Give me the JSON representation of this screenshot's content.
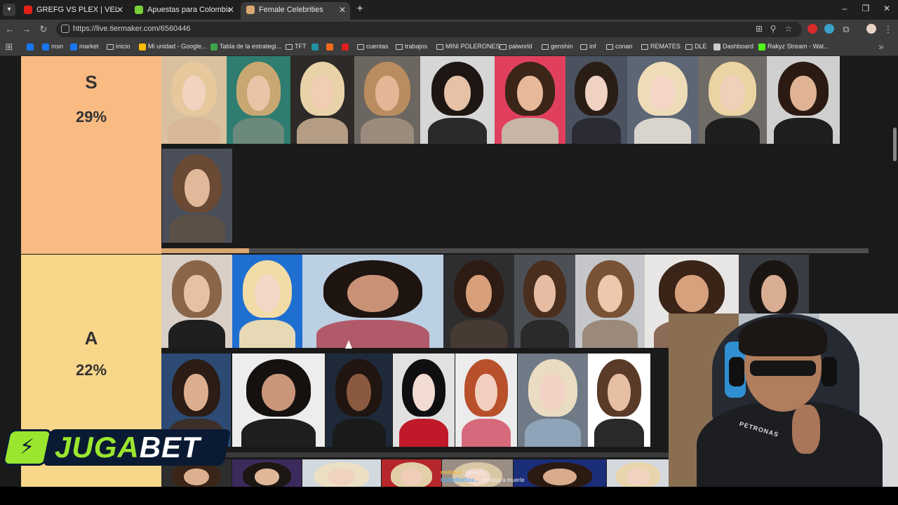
{
  "browser": {
    "tabs": [
      {
        "title": "GREFG VS PLEX | VELADA DEL AÑO",
        "favicon_color": "#e62117",
        "active": false
      },
      {
        "title": "Apuestas para Colombia vs Francia",
        "favicon_color": "#7ad03a",
        "active": false
      },
      {
        "title": "Female Celebrities",
        "favicon_color": "#d9a870",
        "active": true
      }
    ],
    "url": "https://live.tiermaker.com/6560446",
    "new_tab_symbol": "+",
    "bookmarks": [
      {
        "label": "",
        "kind": "site",
        "color": "#1877f2"
      },
      {
        "label": "msn",
        "kind": "site",
        "color": "#1877f2"
      },
      {
        "label": "market",
        "kind": "site",
        "color": "#1877f2"
      },
      {
        "label": "inicio",
        "kind": "folder"
      },
      {
        "label": "Mi unidad - Google...",
        "kind": "site",
        "color": "#fbbc04"
      },
      {
        "label": "Tabla de la estrategi...",
        "kind": "site",
        "color": "#3fa34d"
      },
      {
        "label": "TFT",
        "kind": "folder"
      },
      {
        "label": "",
        "kind": "site",
        "color": "#1e90a0"
      },
      {
        "label": "",
        "kind": "site",
        "color": "#f26b1d"
      },
      {
        "label": "",
        "kind": "site",
        "color": "#e01e1e"
      },
      {
        "label": "cuentas",
        "kind": "folder"
      },
      {
        "label": "trabajos",
        "kind": "folder"
      },
      {
        "label": "MINI POLERONES",
        "kind": "folder"
      },
      {
        "label": "palworld",
        "kind": "folder"
      },
      {
        "label": "genshin",
        "kind": "folder"
      },
      {
        "label": "inf",
        "kind": "folder"
      },
      {
        "label": "conan",
        "kind": "folder"
      },
      {
        "label": "REMATES",
        "kind": "folder"
      },
      {
        "label": "DLE",
        "kind": "folder"
      },
      {
        "label": "Dashboard",
        "kind": "site",
        "color": "#cccccc"
      },
      {
        "label": "Rakyz Stream - Wat...",
        "kind": "site",
        "color": "#53fc18"
      }
    ]
  },
  "tierlist": {
    "tiers": [
      {
        "letter": "S",
        "percent": "29%",
        "color": "#f9bb82"
      },
      {
        "letter": "A",
        "percent": "22%",
        "color": "#f9d78a"
      }
    ],
    "s_row_photos": [
      {
        "hair": "#e7c89c",
        "skin": "#f1d3bf",
        "bg": "#d9c1a0",
        "cloth": "#d8b898"
      },
      {
        "hair": "#c9a773",
        "skin": "#e9c4a6",
        "bg": "#2f7d70",
        "cloth": "#6b8a7c"
      },
      {
        "hair": "#e8d3a8",
        "skin": "#f0cdb3",
        "bg": "#2d2a28",
        "cloth": "#b49d84"
      },
      {
        "hair": "#b98d5f",
        "skin": "#e3b696",
        "bg": "#6c6660",
        "cloth": "#9a8b7c"
      },
      {
        "hair": "#1d1613",
        "skin": "#e6c1a6",
        "bg": "#d6d6d6",
        "cloth": "#2a2a2a"
      },
      {
        "hair": "#3b2518",
        "skin": "#e7b99b",
        "bg": "#e0405e",
        "cloth": "#c7b6a8"
      },
      {
        "hair": "#2a1d16",
        "skin": "#f0d2c2",
        "bg": "#4a5260",
        "cloth": "#2b2b33"
      },
      {
        "hair": "#eedcb8",
        "skin": "#f3d6c6",
        "bg": "#5c6675",
        "cloth": "#d9d4cc"
      },
      {
        "hair": "#ead4a3",
        "skin": "#f0cfbb",
        "bg": "#6f6b66",
        "cloth": "#1e1e1e"
      },
      {
        "hair": "#2a1a12",
        "skin": "#e0b394",
        "bg": "#cfcfcf",
        "cloth": "#1e1e1e"
      },
      {
        "hair": "#6a4a34",
        "skin": "#e1b899",
        "bg": "#4a4e58",
        "cloth": "#5b5046"
      }
    ],
    "a_row1_photos": [
      {
        "hair": "#8a6548",
        "skin": "#e8c0a2",
        "bg": "#d9cfc6",
        "cloth": "#1f1f1f"
      },
      {
        "hair": "#f1dba7",
        "skin": "#f3d7c7",
        "bg": "#1f6fd1",
        "cloth": "#e7d9b6"
      },
      {
        "hair": "#1e1410",
        "skin": "#c99276",
        "bg": "#bcd0e3",
        "cloth": "#b05a6a"
      },
      {
        "hair": "#2d1c14",
        "skin": "#d7a07a",
        "bg": "#2e2e30",
        "cloth": "#463a33"
      },
      {
        "hair": "#4a2e1e",
        "skin": "#e6bda3",
        "bg": "#4c4f55",
        "cloth": "#2a2a2a"
      },
      {
        "hair": "#7a5236",
        "skin": "#eec7ad",
        "bg": "#c4c6ca",
        "cloth": "#9b8a7b"
      },
      {
        "hair": "#3a2418",
        "skin": "#d8a17e",
        "bg": "#e8e6e4",
        "cloth": "#8b6a57"
      },
      {
        "hair": "#1b1512",
        "skin": "#d8ad92",
        "bg": "#3a3c44",
        "cloth": "#2b2b2b"
      }
    ],
    "a_row2_photos": [
      {
        "hair": "#2b1d16",
        "skin": "#dcae90",
        "bg": "#2c4a73",
        "cloth": "#3c2e28"
      },
      {
        "hair": "#15110f",
        "skin": "#c9967a",
        "bg": "#ededed",
        "cloth": "#1e1e1e"
      },
      {
        "hair": "#201510",
        "skin": "#8a5a40",
        "bg": "#1e2a3a",
        "cloth": "#1a1a1a"
      },
      {
        "hair": "#0f0f12",
        "skin": "#f2dcd2",
        "bg": "#e1e1e1",
        "cloth": "#c01a2a"
      },
      {
        "hair": "#b8502c",
        "skin": "#f2cfc0",
        "bg": "#ececec",
        "cloth": "#d66a7c"
      },
      {
        "hair": "#e9dcc2",
        "skin": "#f2d2c4",
        "bg": "#6f7a86",
        "cloth": "#8fa4b8"
      },
      {
        "hair": "#5a3a28",
        "skin": "#e7bfa3",
        "bg": "#ffffff",
        "cloth": "#2a2a2a"
      }
    ],
    "a_row3_photos": [
      {
        "hair": "#3a2518",
        "skin": "#dcb090",
        "bg": "#2d2d2d",
        "cloth": "#2d2d2d"
      },
      {
        "hair": "#1d1713",
        "skin": "#e0b797",
        "bg": "#3d2a5c",
        "cloth": "#2d2d2d"
      },
      {
        "hair": "#ece0c4",
        "skin": "#f0d2c0",
        "bg": "#d1d8de",
        "cloth": "#2d2d2d"
      },
      {
        "hair": "#e2cfa8",
        "skin": "#efcdb9",
        "bg": "#b5272a",
        "cloth": "#2d2d2d"
      },
      {
        "hair": "#d9c8a6",
        "skin": "#f2d6c6",
        "bg": "#9a8d84",
        "cloth": "#2d2d2d"
      },
      {
        "hair": "#2a1a12",
        "skin": "#d9ac8c",
        "bg": "#1b2e7a",
        "cloth": "#2d2d2d"
      },
      {
        "hair": "#e8d5ae",
        "skin": "#f1d3c2",
        "bg": "#d5d9de",
        "cloth": "#2d2d2d"
      }
    ],
    "s_row_scroll_fraction": 0.124
  },
  "overlay": {
    "sponsor_text_a": "JUGA",
    "sponsor_text_b": "BET",
    "webcam_shirt_text": "PETRONAS",
    "chat": [
      {
        "user": "midokiri",
        "message": ": gjkasdg"
      },
      {
        "user": "CorteKloSex...",
        "message": ": banque a muerte"
      }
    ]
  },
  "colors": {
    "page_bg": "#1a1a1a",
    "tier_s": "#f9bb82",
    "tier_a": "#f9d78a",
    "sponsor_green": "#9ae62e"
  }
}
